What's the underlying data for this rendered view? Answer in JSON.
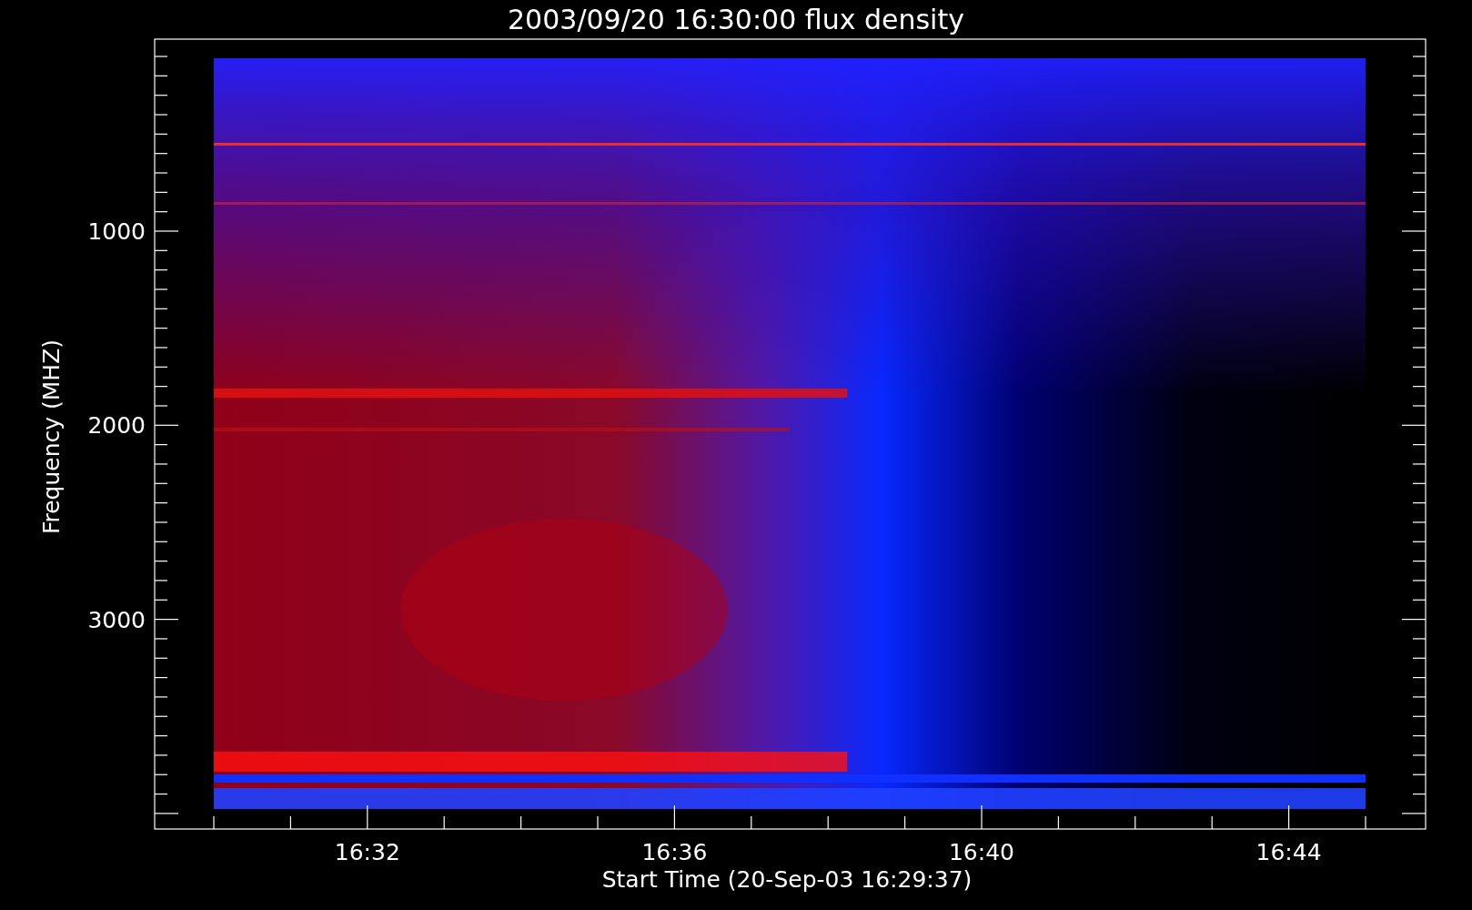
{
  "title": "2003/09/20 16:30:00 flux density",
  "y_axis": {
    "label": "Frequency (MHZ)",
    "ticks": [
      {
        "label": "1000"
      },
      {
        "label": "2000"
      },
      {
        "label": "3000"
      }
    ]
  },
  "x_axis": {
    "label": "Start Time (20-Sep-03 16:29:37)",
    "ticks": [
      {
        "label": "16:32"
      },
      {
        "label": "16:36"
      },
      {
        "label": "16:40"
      },
      {
        "label": "16:44"
      }
    ]
  }
}
